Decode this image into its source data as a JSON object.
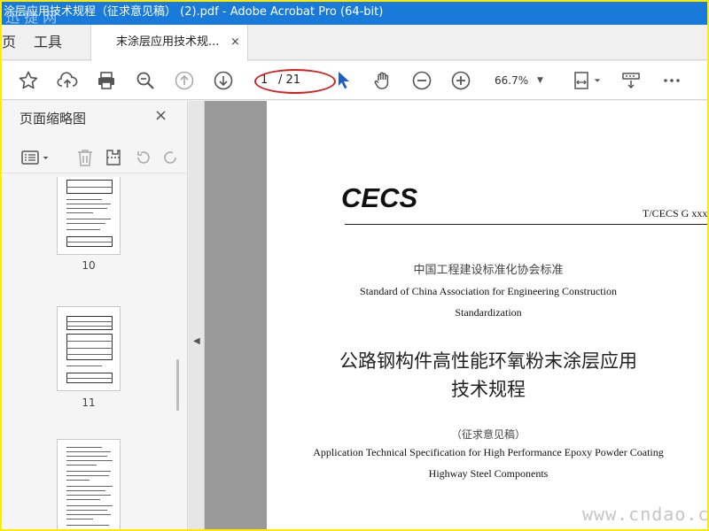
{
  "window": {
    "title": "涂层应用技术规程（征求意见稿） (2).pdf - Adobe Acrobat Pro (64-bit)",
    "watermark_top": "迅 捷 网"
  },
  "tabs": {
    "home_partial": "页",
    "tools": "工具",
    "document": "末涂层应用技术规...",
    "close": "×"
  },
  "toolbar": {
    "icons": [
      "star-icon",
      "upload-icon",
      "print-icon",
      "search-zoom-icon",
      "page-up-icon",
      "page-down-icon",
      "pointer-icon",
      "hand-icon",
      "zoom-out-icon",
      "zoom-in-icon",
      "fit-page-icon",
      "scroll-mode-icon",
      "more-icon"
    ],
    "page_current": "1",
    "page_total": "/ 21",
    "zoom": "66.7%"
  },
  "sidebar": {
    "title": "页面缩略图",
    "close": "×",
    "thumbnails": [
      {
        "number": "10"
      },
      {
        "number": "11"
      },
      {
        "number": ""
      }
    ]
  },
  "document": {
    "logo": "CECS",
    "code": "T/CECS G xxx",
    "association_cn": "中国工程建设标准化协会标准",
    "association_en_1": "Standard of China Association for Engineering Construction",
    "association_en_2": "Standardization",
    "title_cn_1": "公路钢构件高性能环氧粉末涂层应用",
    "title_cn_2": "技术规程",
    "draft_note": "（征求意见稿）",
    "title_en_1": "Application Technical Specification for High Performance Epoxy Powder Coating",
    "title_en_2": "Highway Steel Components",
    "watermark": "www.cndao.com"
  },
  "colors": {
    "titlebar": "#1a7ad9",
    "frame": "#ffeb00",
    "annotation": "#d81e1e",
    "pointer": "#1f5fbf"
  }
}
